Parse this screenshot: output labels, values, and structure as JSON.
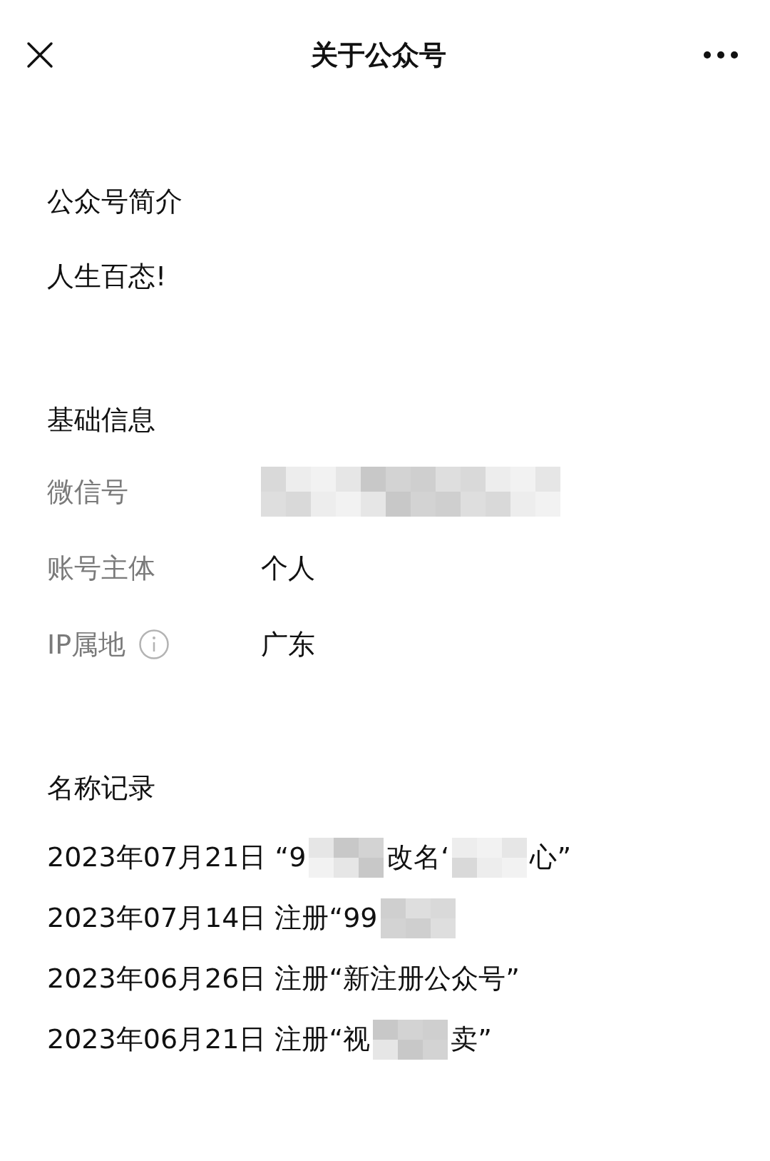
{
  "header": {
    "title": "关于公众号"
  },
  "intro": {
    "heading": "公众号简介",
    "text": "人生百态!"
  },
  "basic": {
    "heading": "基础信息",
    "rows": [
      {
        "label": "微信号",
        "info_icon": false,
        "parts": [
          {
            "kind": "mosaic"
          }
        ]
      },
      {
        "label": "账号主体",
        "info_icon": false,
        "parts": [
          {
            "kind": "text",
            "text": "个人"
          }
        ]
      },
      {
        "label": "IP属地",
        "info_icon": true,
        "parts": [
          {
            "kind": "text",
            "text": "广东"
          }
        ]
      }
    ]
  },
  "names": {
    "heading": "名称记录",
    "rows": [
      {
        "parts": [
          {
            "kind": "text",
            "text": "2023年07月21日 “9"
          },
          {
            "kind": "mosaic"
          },
          {
            "kind": "text",
            "text": "改名‘"
          },
          {
            "kind": "mosaic"
          },
          {
            "kind": "text",
            "text": "心”"
          }
        ]
      },
      {
        "parts": [
          {
            "kind": "text",
            "text": "2023年07月14日 注册“99"
          },
          {
            "kind": "mosaic"
          }
        ]
      },
      {
        "parts": [
          {
            "kind": "text",
            "text": "2023年06月26日 注册“新注册公众号”"
          }
        ]
      },
      {
        "parts": [
          {
            "kind": "text",
            "text": "2023年06月21日 注册“视"
          },
          {
            "kind": "mosaic"
          },
          {
            "kind": "text",
            "text": "卖”"
          }
        ]
      }
    ]
  }
}
